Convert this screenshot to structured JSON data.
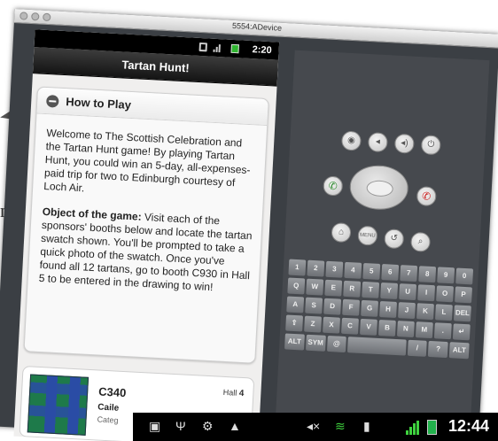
{
  "window": {
    "title": "5554:ADevice"
  },
  "phone_status": {
    "time": "2:20"
  },
  "app": {
    "title": "Tartan Hunt!"
  },
  "how_to_play": {
    "title": "How to Play",
    "intro": "Welcome to The Scottish Celebration and the Tartan Hunt game! By playing Tartan Hunt, you could win an 5-day, all-expenses-paid trip for two to Edinburgh courtesy of Loch Air.",
    "object_label": "Object of the game:",
    "object_text": " Visit each of the sponsors' booths below and locate the tartan swatch shown. You'll be prompted to take a quick photo of the swatch. Once you've found all 12 tartans, go to booth C930 in Hall 5 to be entered in the drawing to win!"
  },
  "booth_item": {
    "booth": "C340",
    "hall_label": "Hall",
    "hall_number": "4",
    "sponsor": "Caile",
    "category": "Categ"
  },
  "emulator_controls": {
    "row1": [
      "camera-icon",
      "volume-down-icon",
      "volume-up-icon",
      "power-icon"
    ],
    "menu_label": "MENU"
  },
  "keyboard": {
    "row1": [
      "1",
      "2",
      "3",
      "4",
      "5",
      "6",
      "7",
      "8",
      "9",
      "0"
    ],
    "row2": [
      "Q",
      "W",
      "E",
      "R",
      "T",
      "Y",
      "U",
      "I",
      "O",
      "P"
    ],
    "row3": [
      "A",
      "S",
      "D",
      "F",
      "G",
      "H",
      "J",
      "K",
      "L",
      "DEL"
    ],
    "row4": [
      "⇧",
      "Z",
      "X",
      "C",
      "V",
      "B",
      "N",
      "M",
      ".",
      "↵"
    ],
    "row5": [
      "ALT",
      "SYM",
      "@",
      "",
      "",
      "/",
      "?",
      "ALT"
    ]
  },
  "system_bar": {
    "time": "12:44"
  },
  "margin": {
    "text": "n"
  },
  "colors": {
    "screen_bg": "#f0efee",
    "emulator_bg": "#3b3f44",
    "battery_green": "#22b14c"
  }
}
